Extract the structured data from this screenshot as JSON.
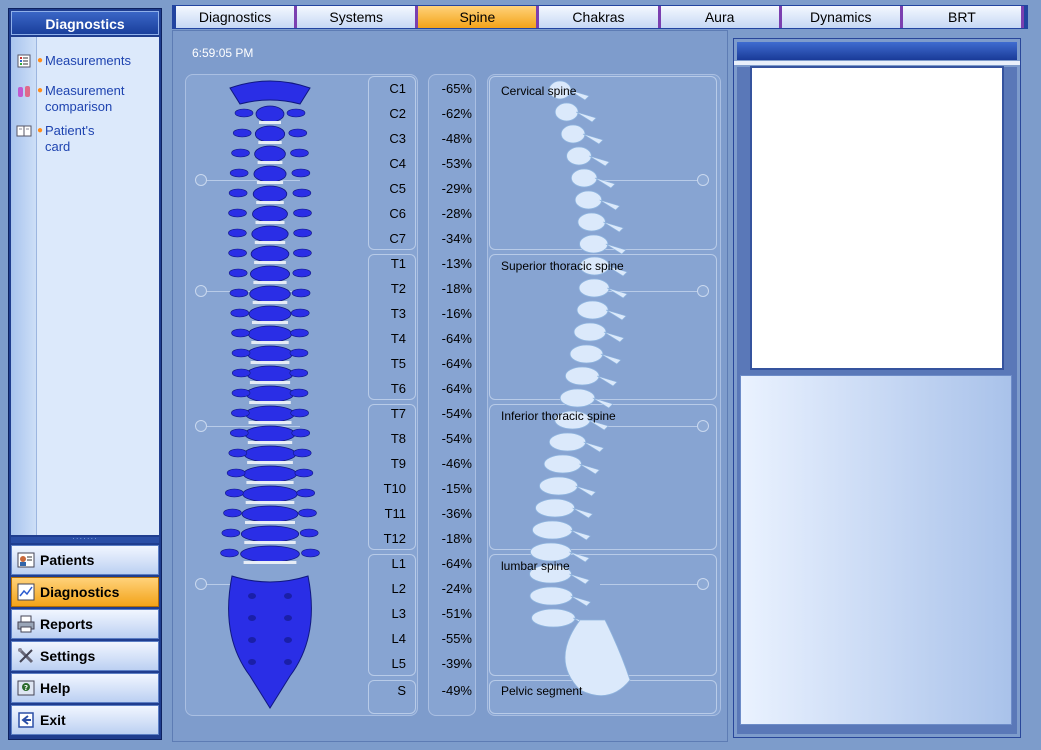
{
  "sidebar": {
    "title": "Diagnostics",
    "items": [
      {
        "label": "Measurements",
        "icon": "list-icon"
      },
      {
        "label": "Measurement comparison",
        "icon": "flasks-icon"
      },
      {
        "label": "Patient's card",
        "icon": "book-icon"
      }
    ],
    "grip": "·······",
    "nav": [
      {
        "label": "Patients",
        "icon": "patients-icon"
      },
      {
        "label": "Diagnostics",
        "icon": "chart-icon"
      },
      {
        "label": "Reports",
        "icon": "printer-icon"
      },
      {
        "label": "Settings",
        "icon": "tools-icon"
      },
      {
        "label": "Help",
        "icon": "help-icon"
      },
      {
        "label": "Exit",
        "icon": "exit-icon"
      }
    ],
    "active_nav": "Diagnostics"
  },
  "tabs": [
    "Diagnostics",
    "Systems",
    "Spine",
    "Chakras",
    "Aura",
    "Dynamics",
    "BRT"
  ],
  "active_tab": "Spine",
  "time": "6:59:05 PM",
  "vertebrae": [
    {
      "label": "C1",
      "pct": "-65%"
    },
    {
      "label": "C2",
      "pct": "-62%"
    },
    {
      "label": "C3",
      "pct": "-48%"
    },
    {
      "label": "C4",
      "pct": "-53%"
    },
    {
      "label": "C5",
      "pct": "-29%"
    },
    {
      "label": "C6",
      "pct": "-28%"
    },
    {
      "label": "C7",
      "pct": "-34%"
    },
    {
      "label": "T1",
      "pct": "-13%"
    },
    {
      "label": "T2",
      "pct": "-18%"
    },
    {
      "label": "T3",
      "pct": "-16%"
    },
    {
      "label": "T4",
      "pct": "-64%"
    },
    {
      "label": "T5",
      "pct": "-64%"
    },
    {
      "label": "T6",
      "pct": "-64%"
    },
    {
      "label": "T7",
      "pct": "-54%"
    },
    {
      "label": "T8",
      "pct": "-54%"
    },
    {
      "label": "T9",
      "pct": "-46%"
    },
    {
      "label": "T10",
      "pct": "-15%"
    },
    {
      "label": "T11",
      "pct": "-36%"
    },
    {
      "label": "T12",
      "pct": "-18%"
    },
    {
      "label": "L1",
      "pct": "-64%"
    },
    {
      "label": "L2",
      "pct": "-24%"
    },
    {
      "label": "L3",
      "pct": "-51%"
    },
    {
      "label": "L4",
      "pct": "-55%"
    },
    {
      "label": "L5",
      "pct": "-39%"
    },
    {
      "label": "S",
      "pct": "-49%"
    }
  ],
  "segments": [
    {
      "label": "Cervical spine"
    },
    {
      "label": "Superior thoracic spine"
    },
    {
      "label": "Inferior thoracic spine"
    },
    {
      "label": "lumbar spine"
    },
    {
      "label": "Pelvic segment"
    }
  ],
  "colors": {
    "spine_front": "#2a2ee6",
    "spine_side": "#dbe9fb",
    "accent_orange": "#f3a319",
    "background": "#7d9ccb"
  }
}
